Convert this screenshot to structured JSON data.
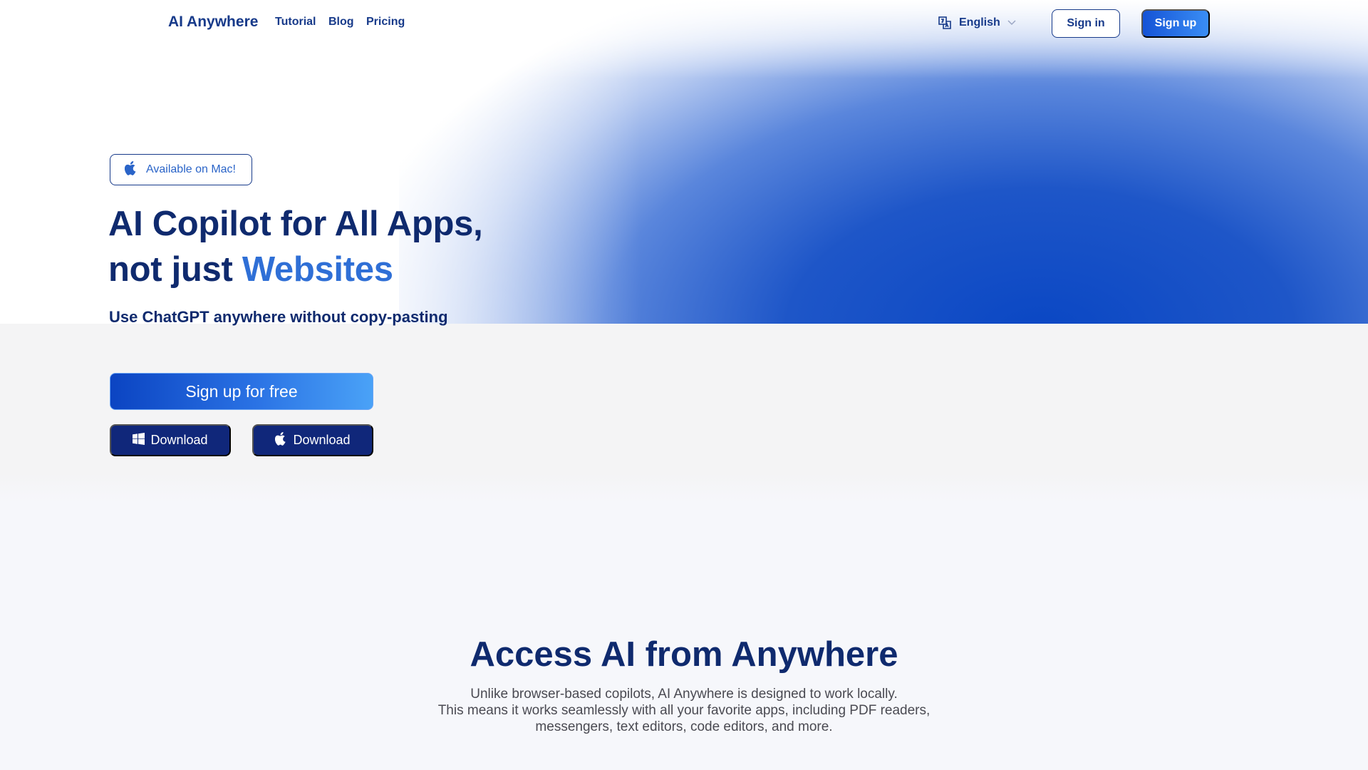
{
  "nav": {
    "brand": "AI Anywhere",
    "links": [
      "Tutorial",
      "Blog",
      "Pricing"
    ],
    "language": "English",
    "sign_in": "Sign in",
    "sign_up": "Sign up"
  },
  "hero": {
    "badge": "Available on Mac!",
    "headline_line1": "AI Copilot for All Apps,",
    "headline_line2_prefix": "not just ",
    "headline_line2_accent": "Websites",
    "subline": "Use ChatGPT anywhere without copy-pasting",
    "cta": "Sign up for free",
    "download_windows": "Download",
    "download_mac": "Download"
  },
  "section": {
    "title": "Access AI from Anywhere",
    "desc_lines": [
      "Unlike browser-based copilots, AI Anywhere is designed to work locally.",
      "This means it works seamlessly with all your favorite apps, including PDF readers,",
      "messengers, text editors, code editors, and more."
    ]
  },
  "icons": {
    "badge": "apple-icon",
    "language": "translate-icon",
    "language_caret": "chevron-down-icon",
    "download_windows": "windows-icon",
    "download_mac": "apple-icon"
  },
  "colors": {
    "primary_dark": "#0f2a6e",
    "accent": "#2f6fd6",
    "button_dark": "#10277a",
    "gradient_start": "#0b44c2",
    "gradient_end": "#4aa2f7"
  }
}
